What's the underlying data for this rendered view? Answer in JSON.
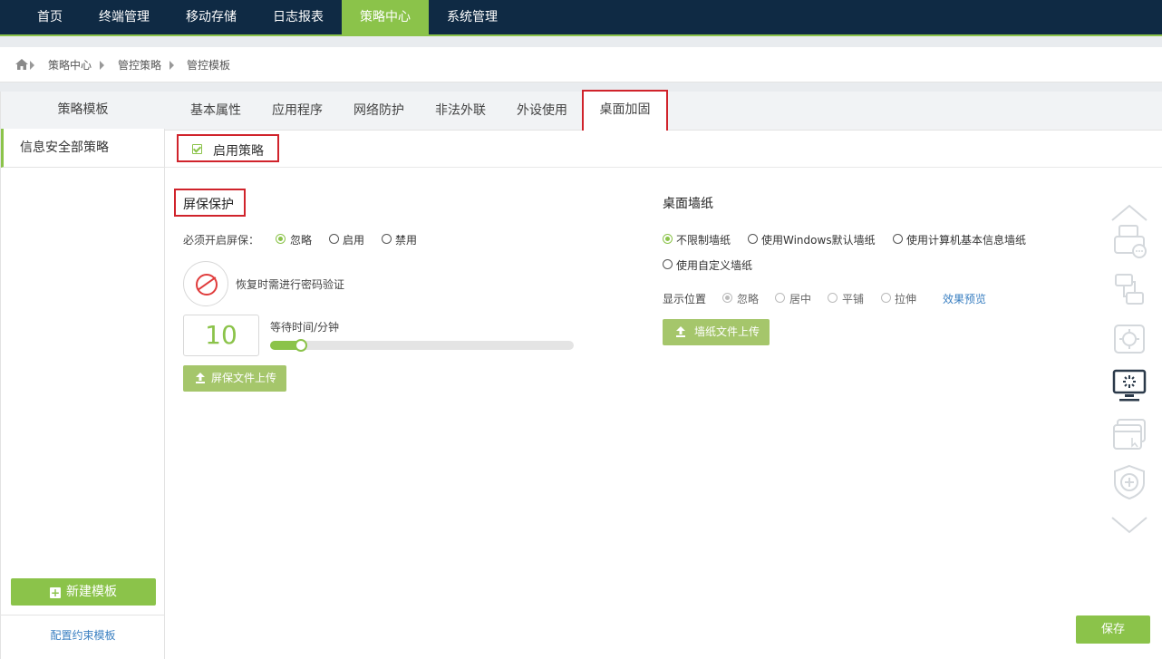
{
  "topnav": {
    "items": [
      "首页",
      "终端管理",
      "移动存储",
      "日志报表",
      "策略中心",
      "系统管理"
    ],
    "active": "策略中心"
  },
  "breadcrumb": [
    "策略中心",
    "管控策略",
    "管控模板"
  ],
  "sidebar": {
    "header": "策略模板",
    "selected_item": "信息安全部策略",
    "new_button": "新建模板",
    "config_link": "配置约束模板"
  },
  "tabs": [
    "基本属性",
    "应用程序",
    "网络防护",
    "非法外联",
    "外设使用",
    "桌面加固"
  ],
  "active_tab": "桌面加固",
  "enable_policy": {
    "label": "启用策略",
    "checked": true
  },
  "screensaver": {
    "title": "屏保保护",
    "required_label": "必须开启屏保：",
    "options": [
      "忽略",
      "启用",
      "禁用"
    ],
    "selected": "忽略",
    "password_label": "恢复时需进行密码验证",
    "wait_value": "10",
    "wait_label": "等待时间/分钟",
    "wait_fraction": 0.08,
    "upload_button": "屏保文件上传"
  },
  "wallpaper": {
    "title": "桌面墙纸",
    "options": [
      "不限制墙纸",
      "使用Windows默认墙纸",
      "使用计算机基本信息墙纸",
      "使用自定义墙纸"
    ],
    "selected": "不限制墙纸",
    "position_label": "显示位置",
    "position_options": [
      "忽略",
      "居中",
      "平铺",
      "拉伸"
    ],
    "position_selected": "忽略",
    "preview_link": "效果预览",
    "upload_button": "墙纸文件上传"
  },
  "save_button": "保存",
  "rail_icons": [
    "chevron-up-icon",
    "printer-icon",
    "network-transfer-icon",
    "gear-chip-icon",
    "desktop-monitor-icon",
    "browser-window-icon",
    "shield-plus-icon",
    "chevron-down-icon"
  ],
  "colors": {
    "nav_bg": "#0f2a44",
    "accent": "#8bc34a",
    "highlight": "#d0232b",
    "link": "#3a7fc1"
  }
}
